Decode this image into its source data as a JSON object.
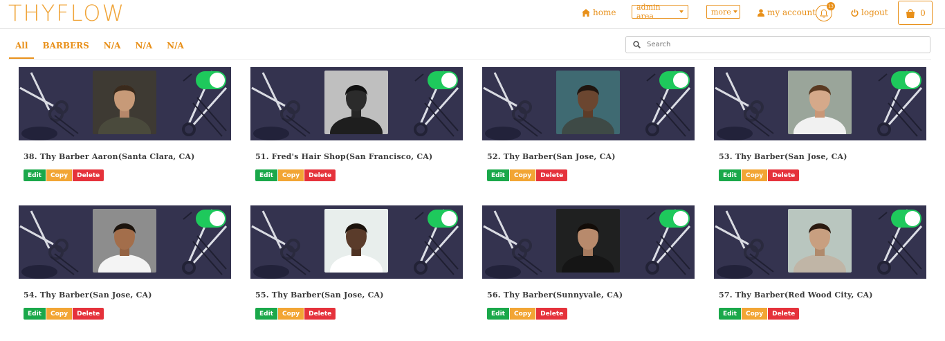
{
  "brand": "THYFLOW",
  "nav": {
    "home": "home",
    "admin_area": "admin area",
    "more": "more",
    "my_account": "my account",
    "notifications_count": "13",
    "logout": "logout",
    "cart_count": "0"
  },
  "tabs": [
    "All",
    "BARBERS",
    "N/A",
    "N/A",
    "N/A"
  ],
  "active_tab": "All",
  "search": {
    "placeholder": "Search"
  },
  "actions": {
    "edit": "Edit",
    "copy": "Copy",
    "delete": "Delete"
  },
  "colors": {
    "accent": "#e8901a",
    "toggle_on": "#1ec95c",
    "edit": "#1aa84a",
    "copy": "#f2a534",
    "delete": "#e5323b"
  },
  "cards": [
    {
      "title": "38. Thy Barber Aaron(Santa Clara, CA)",
      "enabled": true
    },
    {
      "title": "51. Fred's Hair Shop(San Francisco, CA)",
      "enabled": true
    },
    {
      "title": "52. Thy Barber(San Jose, CA)",
      "enabled": true
    },
    {
      "title": "53. Thy Barber(San Jose, CA)",
      "enabled": true
    },
    {
      "title": "54. Thy Barber(San Jose, CA)",
      "enabled": true
    },
    {
      "title": "55. Thy Barber(San Jose, CA)",
      "enabled": true
    },
    {
      "title": "56. Thy Barber(Sunnyvale, CA)",
      "enabled": true
    },
    {
      "title": "57. Thy Barber(Red Wood City, CA)",
      "enabled": true
    }
  ]
}
